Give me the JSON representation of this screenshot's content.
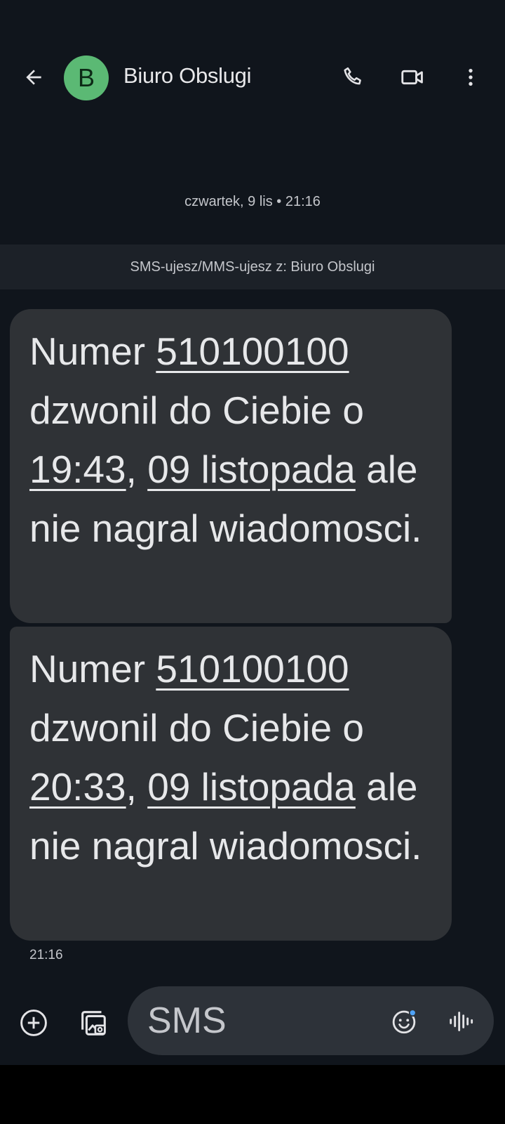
{
  "header": {
    "contact_name": "Biuro Obslugi",
    "avatar_letter": "B",
    "avatar_color": "#5bb974",
    "icons": [
      "arrow-back-icon",
      "phone-icon",
      "video-call-icon",
      "more-vert-icon"
    ]
  },
  "conversation": {
    "date_separator": "czwartek, 9 lis • 21:16",
    "info_bar": "SMS-ujesz/MMS-ujesz z: Biuro Obslugi",
    "messages": [
      {
        "prefix": "Numer ",
        "number": "510100100",
        "middle": " dzwonil do Ciebie o ",
        "time": "19:43",
        "comma": ", ",
        "date": "09 listopada",
        "suffix": " ale nie nagral wiadomosci."
      },
      {
        "prefix": "Numer ",
        "number": "510100100",
        "middle": " dzwonil do Ciebie o ",
        "time": "20:33",
        "comma": ", ",
        "date": "09 listopada",
        "suffix": " ale nie nagral wiadomosci."
      }
    ],
    "timestamp": "21:16"
  },
  "composer": {
    "placeholder": "SMS",
    "icons": [
      "add-circle-icon",
      "gallery-icon",
      "emoji-icon",
      "voice-icon"
    ]
  },
  "colors": {
    "background": "#10151c",
    "bubble": "#2f3236",
    "accent_dot": "#4fa3f7"
  }
}
